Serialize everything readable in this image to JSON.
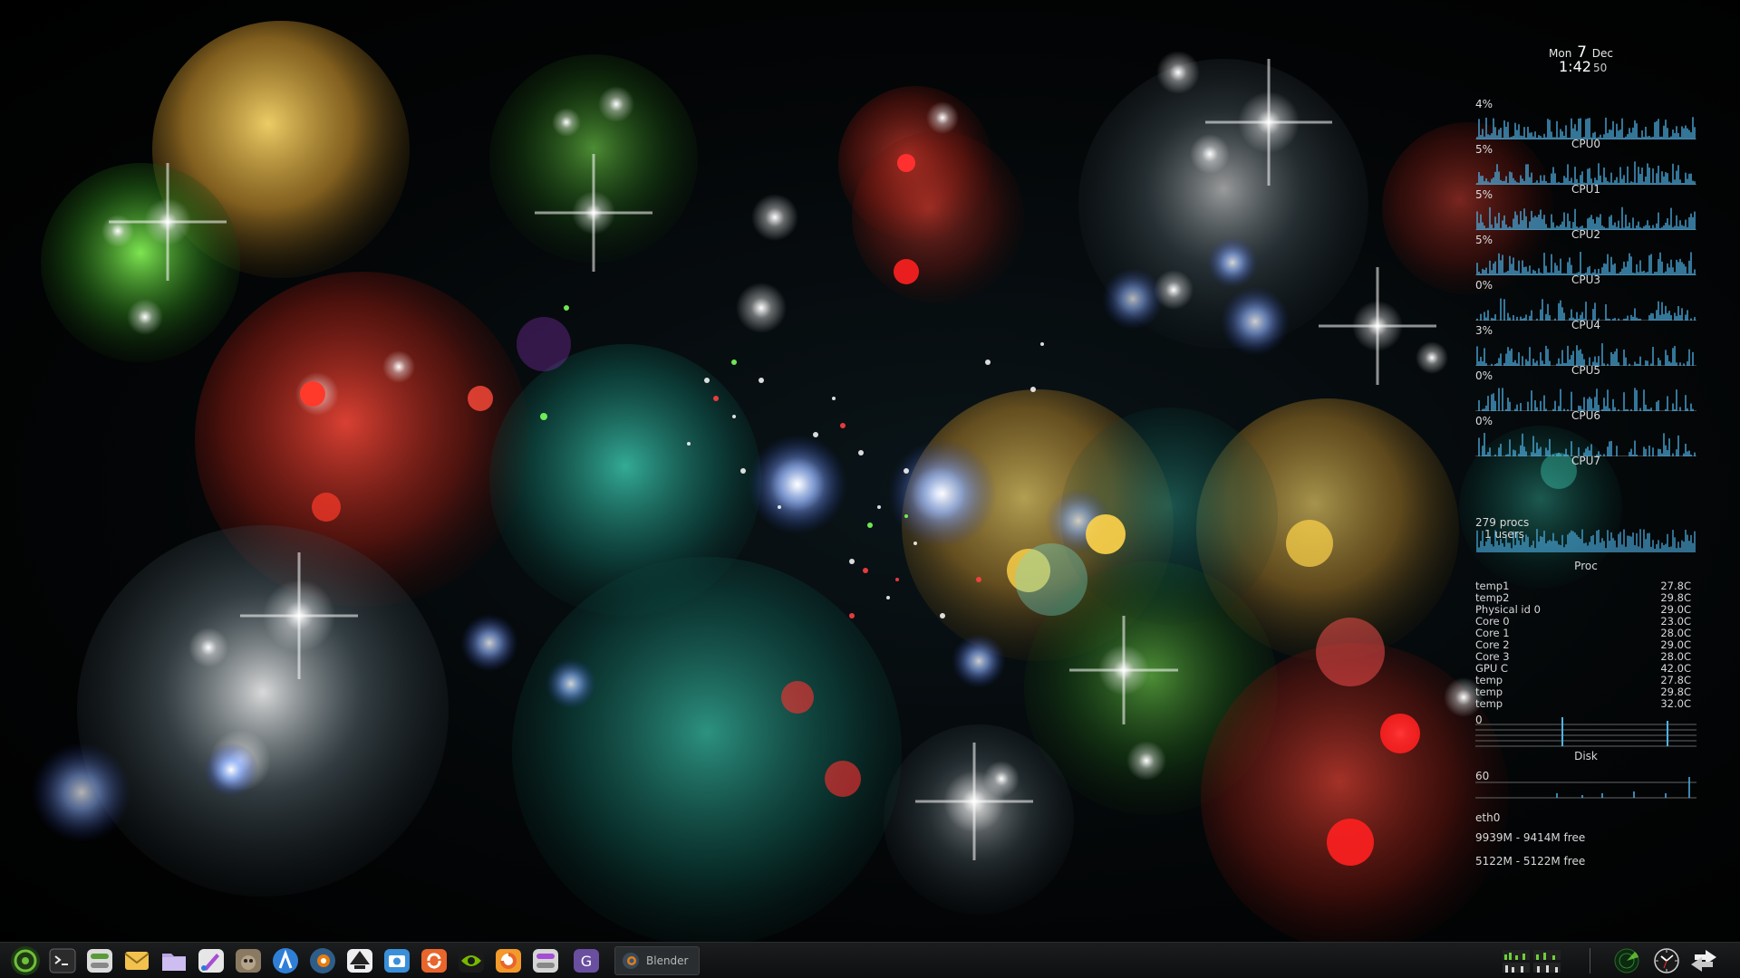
{
  "clock": {
    "weekday": "Mon",
    "day": "7",
    "month": "Dec",
    "time": "1:42",
    "seconds": "50"
  },
  "cpus": [
    {
      "label": "CPU0",
      "percent": "4%"
    },
    {
      "label": "CPU1",
      "percent": "5%"
    },
    {
      "label": "CPU2",
      "percent": "5%"
    },
    {
      "label": "CPU3",
      "percent": "5%"
    },
    {
      "label": "CPU4",
      "percent": "0%"
    },
    {
      "label": "CPU5",
      "percent": "3%"
    },
    {
      "label": "CPU6",
      "percent": "0%"
    },
    {
      "label": "CPU7",
      "percent": "0%"
    }
  ],
  "proc": {
    "procs": "279 procs",
    "users": "1 users",
    "label": "Proc"
  },
  "temps": [
    {
      "name": "temp1",
      "value": "27.8C"
    },
    {
      "name": "temp2",
      "value": "29.8C"
    },
    {
      "name": "Physical id 0",
      "value": "29.0C"
    },
    {
      "name": "Core 0",
      "value": "23.0C"
    },
    {
      "name": "Core 1",
      "value": "28.0C"
    },
    {
      "name": "Core 2",
      "value": "29.0C"
    },
    {
      "name": "Core 3",
      "value": "28.0C"
    },
    {
      "name": "GPU C",
      "value": "42.0C"
    },
    {
      "name": "temp",
      "value": "27.8C"
    },
    {
      "name": "temp",
      "value": "29.8C"
    },
    {
      "name": "temp",
      "value": "32.0C"
    }
  ],
  "disk": {
    "percent": "0",
    "label": "Disk"
  },
  "net": {
    "percent": "60",
    "interface": "eth0"
  },
  "memory": {
    "line1": "9939M - 9414M free",
    "line2": "5122M - 5122M free"
  },
  "taskbar": {
    "launchers": [
      {
        "name": "opensuse-menu-icon",
        "color": "#6fbf3a"
      },
      {
        "name": "terminal-icon",
        "color": "#2b2b2b"
      },
      {
        "name": "settings-switch-icon",
        "color": "#dcdcdc"
      },
      {
        "name": "mail-icon",
        "color": "#f2c14e"
      },
      {
        "name": "file-manager-icon",
        "color": "#b9a6e0"
      },
      {
        "name": "paint-brush-icon",
        "color": "#e6e6e6"
      },
      {
        "name": "gimp-icon",
        "color": "#b5a48a"
      },
      {
        "name": "kdenlive-icon",
        "color": "#2f7fd6"
      },
      {
        "name": "blender-icon",
        "color": "#2f5d8a"
      },
      {
        "name": "inkscape-icon",
        "color": "#efefef"
      },
      {
        "name": "screenshot-icon",
        "color": "#3a8fd9"
      },
      {
        "name": "update-icon",
        "color": "#e8652b"
      },
      {
        "name": "nvidia-icon",
        "color": "#76b900"
      },
      {
        "name": "firefox-icon",
        "color": "#f39a2b"
      },
      {
        "name": "toggle-icon",
        "color": "#d5d5d5"
      },
      {
        "name": "gnome-extensions-icon",
        "color": "#6a4fa0"
      }
    ],
    "task_title": "Blender"
  }
}
